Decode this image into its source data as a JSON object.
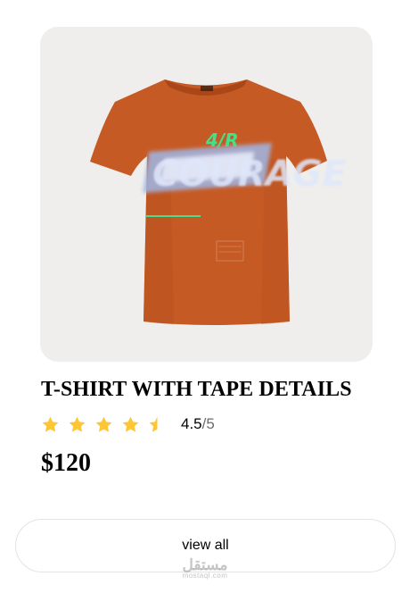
{
  "product": {
    "image_alt": "orange t-shirt",
    "shirt_text": "COURAGE",
    "shirt_accent_text": "4/R",
    "title": "T-SHIRT WITH TAPE DETAILS",
    "rating": {
      "value": "4.5",
      "max": "/5",
      "stars_filled": 4.5,
      "star_color": "#FFC633"
    },
    "price": "$120",
    "shirt_color": "#c65a24"
  },
  "actions": {
    "view_all_label": "view all"
  },
  "watermark": {
    "arabic": "مستقل",
    "latin": "mostaql.com"
  }
}
